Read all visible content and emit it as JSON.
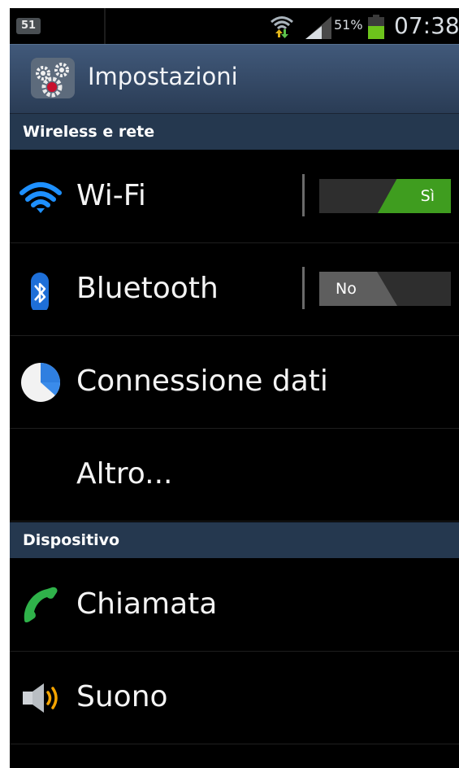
{
  "status_bar": {
    "notification_count": "51",
    "battery_percent": "51%",
    "time": "07:38",
    "icons": [
      "wifi-data-icon",
      "signal-icon",
      "battery-icon"
    ]
  },
  "action_bar": {
    "title": "Impostazioni",
    "icon": "settings-gears-icon"
  },
  "sections": [
    {
      "header": "Wireless e rete",
      "items": [
        {
          "label": "Wi-Fi",
          "icon": "wifi-icon",
          "toggle": "Sì"
        },
        {
          "label": "Bluetooth",
          "icon": "bluetooth-icon",
          "toggle": "No"
        },
        {
          "label": "Connessione dati",
          "icon": "data-usage-icon"
        },
        {
          "label": "Altro..."
        }
      ]
    },
    {
      "header": "Dispositivo",
      "items": [
        {
          "label": "Chiamata",
          "icon": "phone-icon"
        },
        {
          "label": "Suono",
          "icon": "speaker-icon"
        }
      ]
    }
  ],
  "colors": {
    "action_bar": "#34496a",
    "section_header": "#25384f",
    "toggle_on": "#3f9d1f",
    "toggle_off": "#5e5e5e",
    "battery": "#6dc41c"
  }
}
